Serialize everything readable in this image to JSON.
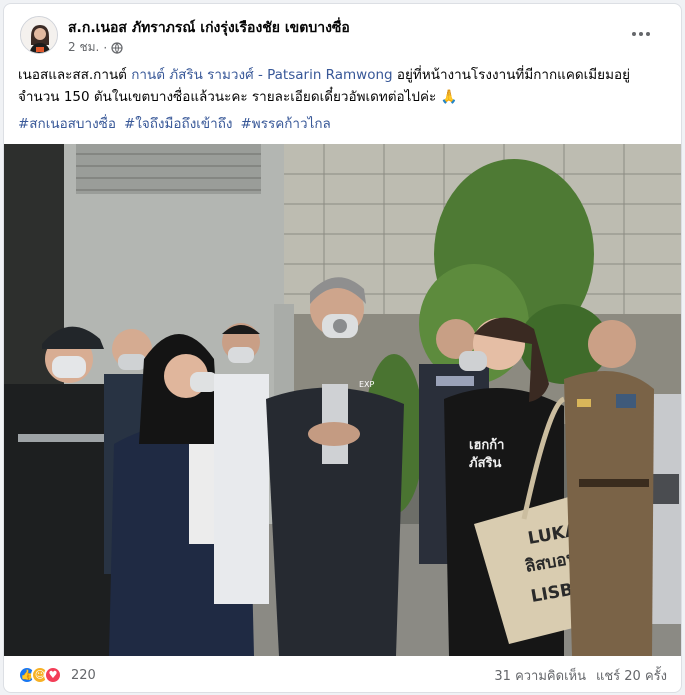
{
  "post": {
    "author": "ส.ก.เนอส ภัทราภรณ์ เก่งรุ่งเรืองชัย เขตบางซื่อ",
    "time": "2 ชม.",
    "privacy_icon": "globe-icon",
    "text_before": "เนอสและสส.กานต์ ",
    "mention": "กานต์ ภัสริน รามวงศ์ - Patsarin Ramwong",
    "text_after": " อยู่ที่หน้างานโรงงานที่มีกากแคดเมียมอยู่จำนวน 150 ตันในเขตบางซื่อแล้วนะคะ รายละเอียดเดี๋ยวอัพเดทต่อไปค่ะ",
    "emoji": "🙏",
    "hashtags": [
      "#สกเนอสบางซื่อ",
      "#ใจถึงมือถึงเข้าถึง",
      "#พรรคก้าวไกล"
    ]
  },
  "photo": {
    "bag_lines": [
      "LUKA",
      "ลิสบอน",
      "LISBOA"
    ],
    "shirt_lines": [
      "เฮกก้า",
      "ภัสริน"
    ],
    "logo_text": "EXP"
  },
  "footer": {
    "reaction_count": "220",
    "comments": "31 ความคิดเห็น",
    "shares": "แชร์ 20 ครั้ง"
  },
  "colors": {
    "link": "#385898",
    "like": "#1877f2",
    "love": "#f33e58",
    "care": "#f7b125"
  }
}
